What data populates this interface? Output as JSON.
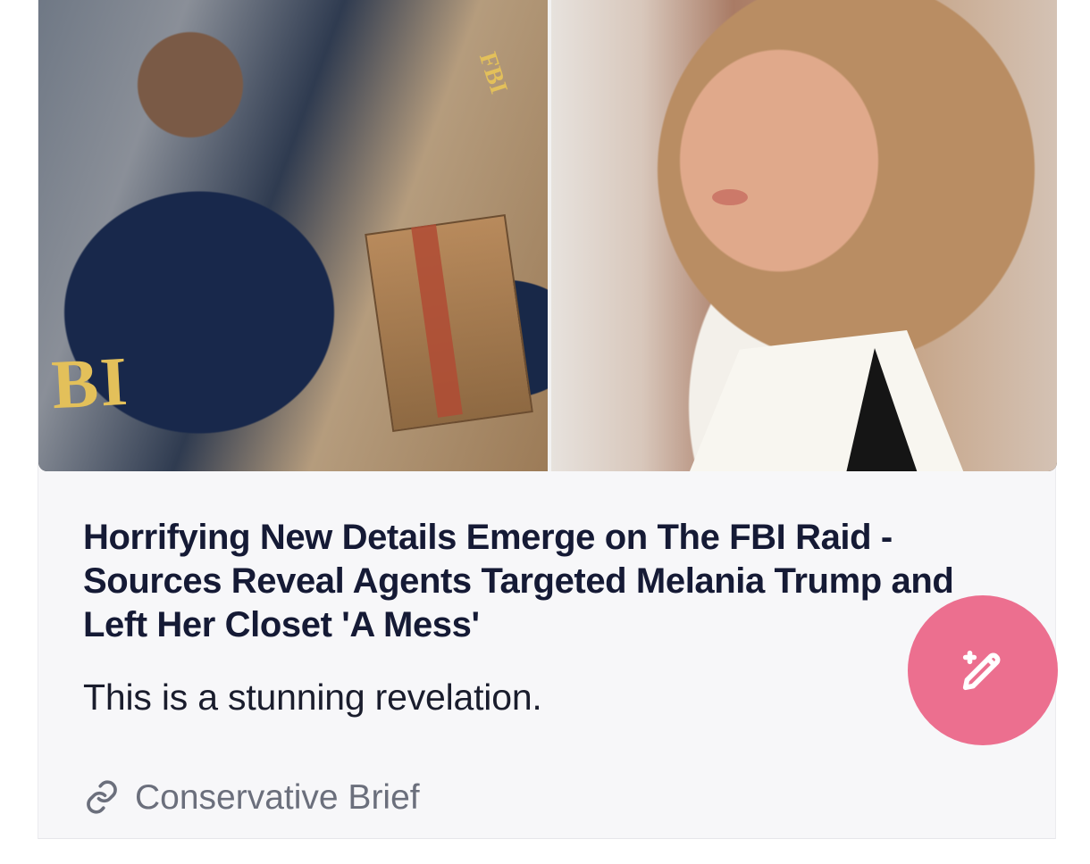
{
  "article": {
    "image_left_label": "BI",
    "image_left_small_label": "FBI",
    "headline": "Horrifying New Details Emerge on The FBI Raid - Sources Reveal Agents Targeted Melania Trump and Left Her Closet 'A Mess'",
    "summary": "This is a stunning revelation.",
    "source_name": "Conservative Brief"
  },
  "actions": {
    "compose_icon": "magic-edit-icon"
  },
  "icons": {
    "source_link": "link-icon"
  },
  "colors": {
    "card_bg": "#f7f7f9",
    "headline": "#151a35",
    "summary": "#1a1d2d",
    "source": "#6b6f7c",
    "fab": "#ec6f8f"
  }
}
